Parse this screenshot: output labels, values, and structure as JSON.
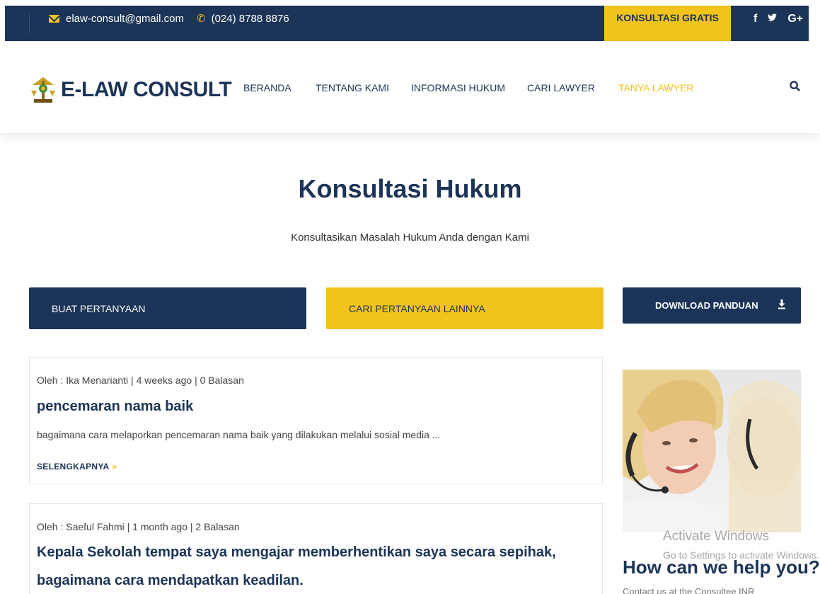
{
  "topbar": {
    "email": "elaw-consult@gmail.com",
    "phone": "(024) 8788 8876",
    "cta": "KONSULTASI GRATIS",
    "social": [
      "f",
      "𝕪",
      "G+"
    ]
  },
  "header": {
    "logo_text": "E-LAW CONSULT",
    "nav": [
      "BERANDA",
      "TENTANG KAMI",
      "INFORMASI HUKUM",
      "CARI LAWYER",
      "TANYA LAWYER"
    ],
    "active_nav": "TANYA LAWYER"
  },
  "hero": {
    "title": "Konsultasi Hukum",
    "subtitle": "Konsultasikan Masalah Hukum Anda dengan Kami"
  },
  "actions": {
    "ask": "BUAT PERTANYAAN",
    "search": "CARI PERTANYAAN LAINNYA",
    "download": "DOWNLOAD PANDUAN"
  },
  "posts": [
    {
      "meta": "Oleh : Ika Menarianti | 4 weeks ago | 0 Balasan",
      "title": "pencemaran nama baik",
      "excerpt": "bagaimana cara melaporkan pencemaran nama baik yang dilakukan melalui sosial media ...",
      "more": "SELENGKAPNYA"
    },
    {
      "meta": "Oleh : Saeful Fahmi | 1 month ago | 2 Balasan",
      "title_line1": "Kepala Sekolah tempat saya mengajar memberhentikan saya secara sepihak,",
      "title_line2": "bagaimana cara mendapatkan keadilan."
    }
  ],
  "sidebar": {
    "help_title": "How can we help you?",
    "help_text": "Contact us at the Consultee INR"
  },
  "watermark": {
    "line1": "Activate Windows",
    "line2": "Go to Settings to activate Windows."
  },
  "colors": {
    "navy": "#1b3457",
    "gold": "#f1c31b"
  }
}
